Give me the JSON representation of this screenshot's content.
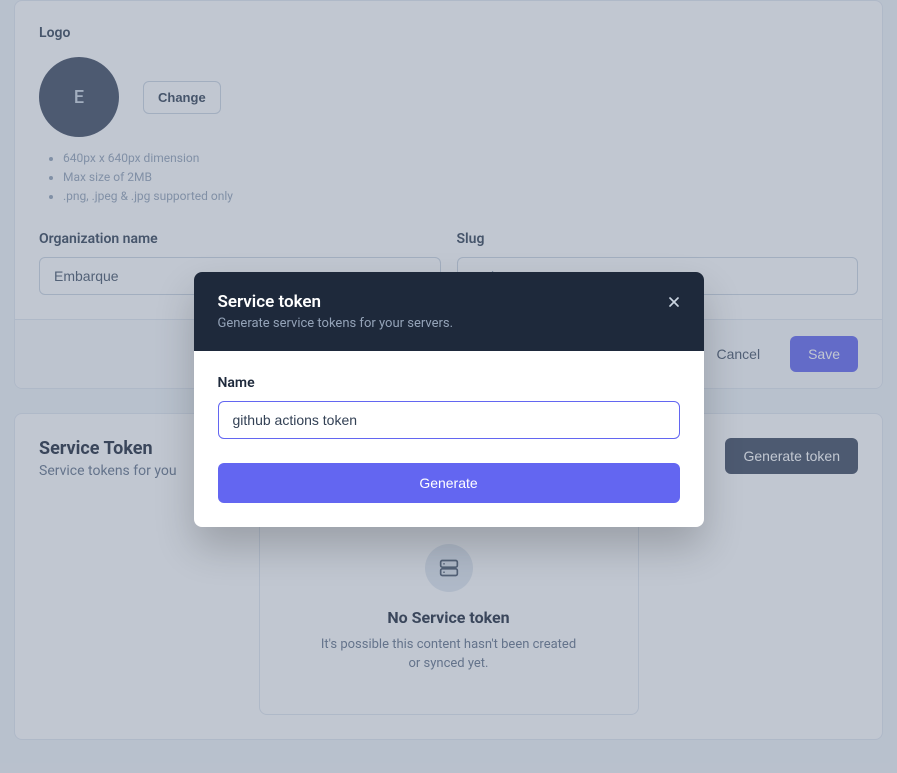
{
  "logo": {
    "label": "Logo",
    "initial": "E",
    "change_label": "Change",
    "hints": [
      "640px x 640px dimension",
      "Max size of 2MB",
      ".png, .jpeg & .jpg supported only"
    ]
  },
  "org": {
    "name_label": "Organization name",
    "name_value": "Embarque",
    "slug_label": "Slug",
    "slug_placeholder": "embarque"
  },
  "actions": {
    "cancel": "Cancel",
    "save": "Save"
  },
  "token_section": {
    "title": "Service Token",
    "subtitle": "Service tokens for you",
    "generate_label": "Generate token",
    "empty_title": "No Service token",
    "empty_desc": "It's possible this content hasn't been created or synced yet."
  },
  "modal": {
    "title": "Service token",
    "subtitle": "Generate service tokens for your servers.",
    "name_label": "Name",
    "name_value": "github actions token",
    "generate_label": "Generate"
  }
}
